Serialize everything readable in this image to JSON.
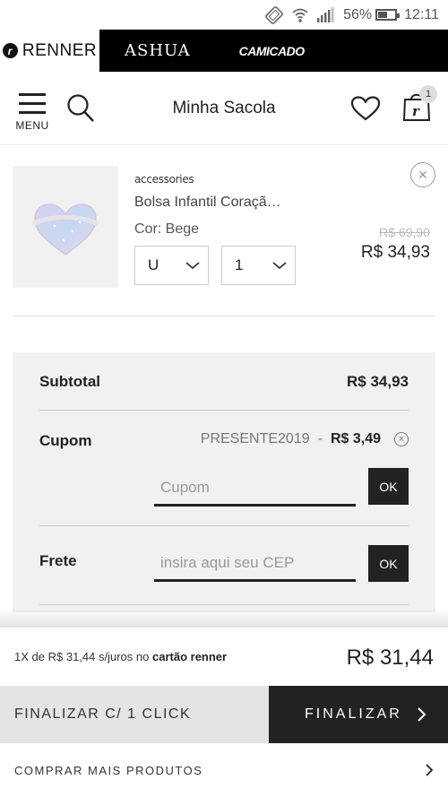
{
  "status_bar": {
    "battery": "56%",
    "time": "12:11"
  },
  "brands": {
    "renner": "RENNER",
    "ashua": "ASHUA",
    "camicado": "CAMICADO"
  },
  "header": {
    "menu_label": "MENU",
    "title": "Minha Sacola",
    "bag_count": "1"
  },
  "product": {
    "brand": "accessories",
    "name": "Bolsa Infantil Coraçã…",
    "color": "Cor: Bege",
    "size": "U",
    "quantity": "1",
    "old_price": "R$ 69,90",
    "price": "R$ 34,93"
  },
  "summary": {
    "subtotal_label": "Subtotal",
    "subtotal_value": "R$ 34,93",
    "cupom_label": "Cupom",
    "coupon_code": "PRESENTE2019",
    "coupon_separator": "-",
    "coupon_discount": "R$ 3,49",
    "cupom_placeholder": "Cupom",
    "ok_label": "OK",
    "frete_label": "Frete",
    "cep_placeholder": "insira aqui seu CEP"
  },
  "footer": {
    "installment_prefix": "1X de",
    "installment_value": "R$ 31,44",
    "installment_suffix": "s/juros no",
    "installment_card": "cartão renner",
    "total": "R$ 31,44",
    "one_click_label": "FINALIZAR C/ 1 CLICK",
    "finalize_label": "FINALIZAR",
    "more_products_label": "COMPRAR MAIS PRODUTOS"
  },
  "colors": {
    "dark": "#222222",
    "panel": "#f1f1f1",
    "brand_bar": "#000000"
  }
}
